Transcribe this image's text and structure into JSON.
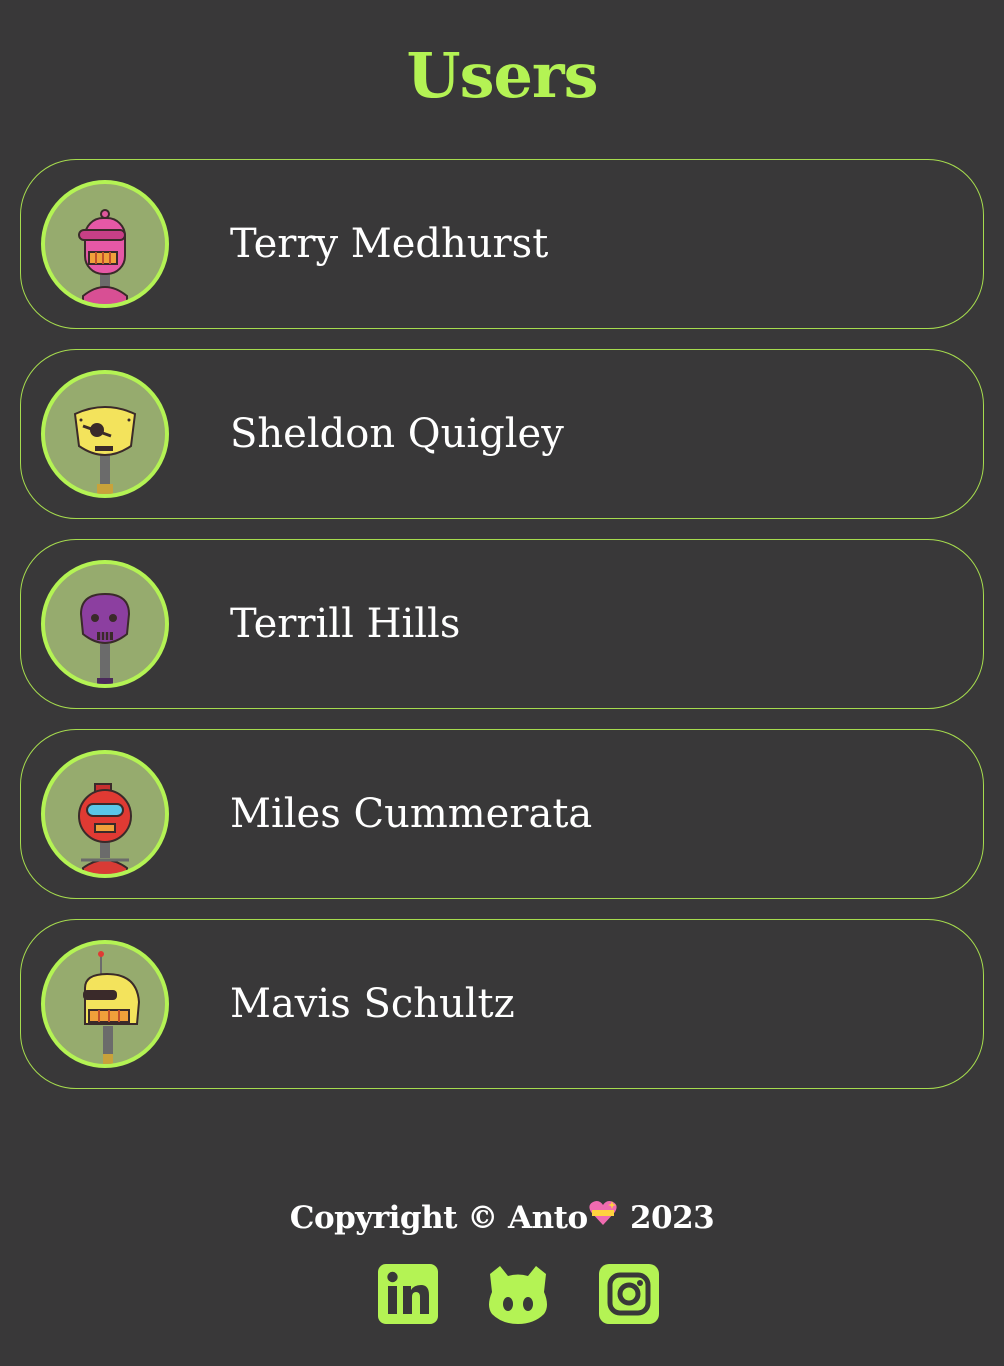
{
  "page": {
    "title": "Users"
  },
  "users": [
    {
      "name": "Terry Medhurst",
      "avatar_icon": "pink-robot-avatar"
    },
    {
      "name": "Sheldon Quigley",
      "avatar_icon": "yellow-robot-avatar"
    },
    {
      "name": "Terrill Hills",
      "avatar_icon": "purple-robot-avatar"
    },
    {
      "name": "Miles Cummerata",
      "avatar_icon": "red-robot-avatar"
    },
    {
      "name": "Mavis Schultz",
      "avatar_icon": "yellow-helmet-robot-avatar"
    }
  ],
  "footer": {
    "copyright_prefix": "Copyright © Anto",
    "copyright_year": "2023",
    "heart_icon": "sparkling-heart-emoji"
  },
  "socials": [
    {
      "icon": "linkedin-icon"
    },
    {
      "icon": "github-icon"
    },
    {
      "icon": "instagram-icon"
    }
  ],
  "colors": {
    "background": "#393839",
    "accent": "#b4f354",
    "card_border": "#a6dc4e",
    "avatar_bg": "#96ab6e",
    "text": "#ffffff"
  }
}
